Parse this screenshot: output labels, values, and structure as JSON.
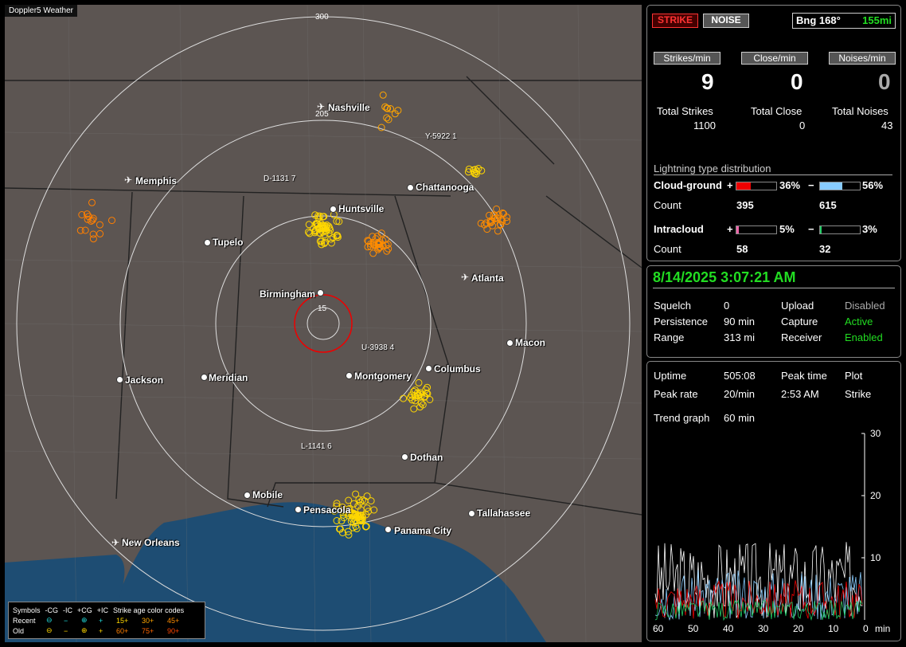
{
  "map": {
    "title": "Doppler5 Weather",
    "ring_labels": [
      "300",
      "205",
      "15"
    ],
    "cities": [
      {
        "name": "Nashville",
        "airport": true
      },
      {
        "name": "Memphis",
        "airport": true
      },
      {
        "name": "Chattanooga",
        "airport": false
      },
      {
        "name": "Huntsville",
        "airport": false
      },
      {
        "name": "Tupelo",
        "airport": false
      },
      {
        "name": "Atlanta",
        "airport": true
      },
      {
        "name": "Birmingham",
        "airport": false
      },
      {
        "name": "Macon",
        "airport": false
      },
      {
        "name": "Jackson",
        "airport": false
      },
      {
        "name": "Meridian",
        "airport": false
      },
      {
        "name": "Montgomery",
        "airport": false
      },
      {
        "name": "Columbus",
        "airport": false
      },
      {
        "name": "Dothan",
        "airport": false
      },
      {
        "name": "Mobile",
        "airport": false
      },
      {
        "name": "Pensacola",
        "airport": false
      },
      {
        "name": "Tallahassee",
        "airport": false
      },
      {
        "name": "Panama City",
        "airport": false
      },
      {
        "name": "New Orleans",
        "airport": true
      }
    ],
    "markers": [
      "Y-5922 1",
      "D-1131 7",
      "U-3938 4",
      "L-1141 6"
    ],
    "legend": {
      "symbols_label": "Symbols",
      "headers": [
        "-CG",
        "-IC",
        "+CG",
        "+IC"
      ],
      "age_title": "Strike age color codes",
      "recent_label": "Recent",
      "old_label": "Old",
      "recent_ages": [
        "15+",
        "30+",
        "45+"
      ],
      "old_ages": [
        "60+",
        "75+",
        "90+"
      ]
    }
  },
  "header": {
    "strike_button": "STRIKE",
    "noise_button": "NOISE",
    "bearing": "Bng 168°",
    "distance": "155mi"
  },
  "rates": {
    "strikes_label": "Strikes/min",
    "close_label": "Close/min",
    "noises_label": "Noises/min",
    "strikes_value": "9",
    "close_value": "0",
    "noises_value": "0",
    "total_strikes_label": "Total Strikes",
    "total_close_label": "Total Close",
    "total_noises_label": "Total Noises",
    "total_strikes": "1100",
    "total_close": "0",
    "total_noises": "43"
  },
  "distribution": {
    "title": "Lightning type distribution",
    "cg_label": "Cloud-ground",
    "ic_label": "Intracloud",
    "count_label": "Count",
    "plus": "+",
    "minus": "−",
    "cg_pos_pct": "36%",
    "cg_neg_pct": "56%",
    "cg_pos_count": "395",
    "cg_neg_count": "615",
    "ic_pos_pct": "5%",
    "ic_neg_pct": "3%",
    "ic_pos_count": "58",
    "ic_neg_count": "32",
    "cg_pos_frac": 0.36,
    "cg_neg_frac": 0.56,
    "ic_pos_frac": 0.05,
    "ic_neg_frac": 0.03
  },
  "status": {
    "datetime": "8/14/2025 3:07:21 AM",
    "squelch_label": "Squelch",
    "squelch": "0",
    "persistence_label": "Persistence",
    "persistence": "90 min",
    "range_label": "Range",
    "range": "313 mi",
    "upload_label": "Upload",
    "upload": "Disabled",
    "capture_label": "Capture",
    "capture": "Active",
    "receiver_label": "Receiver",
    "receiver": "Enabled"
  },
  "trend": {
    "uptime_label": "Uptime",
    "uptime": "505:08",
    "peak_time_label": "Peak time",
    "plot_label": "Plot",
    "peak_rate_label": "Peak rate",
    "peak_rate": "20/min",
    "peak_time": "2:53 AM",
    "plot": "Strike",
    "trend_graph_label": "Trend graph",
    "trend_graph": "60 min",
    "y_ticks": [
      "30",
      "20",
      "10"
    ],
    "x_ticks": [
      "60",
      "50",
      "40",
      "30",
      "20",
      "10",
      "0"
    ],
    "x_unit": "min"
  }
}
